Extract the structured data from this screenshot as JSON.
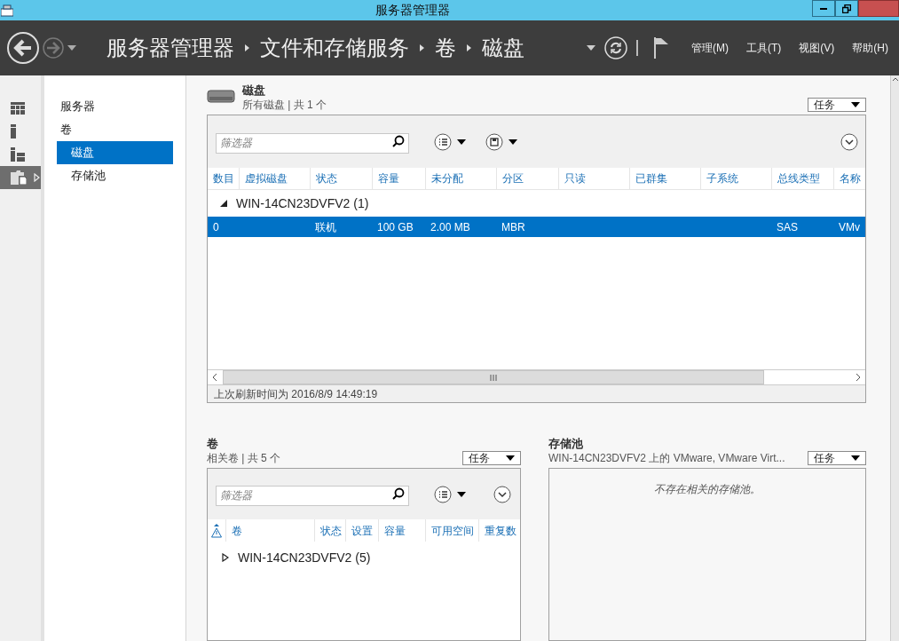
{
  "window": {
    "title": "服务器管理器"
  },
  "nav": {
    "back_enabled": true,
    "forward_enabled": false,
    "breadcrumb": [
      "服务器管理器",
      "文件和存储服务",
      "卷",
      "磁盘"
    ],
    "menus": [
      "管理(M)",
      "工具(T)",
      "视图(V)",
      "帮助(H)"
    ]
  },
  "rail": [
    {
      "kind": "dashboard",
      "selected": false
    },
    {
      "kind": "server",
      "selected": false
    },
    {
      "kind": "servers",
      "selected": false
    },
    {
      "kind": "files",
      "selected": true
    }
  ],
  "nav_panel": [
    {
      "label": "服务器",
      "selected": false
    },
    {
      "label": "卷",
      "selected": false,
      "children": [
        {
          "label": "磁盘",
          "selected": true
        },
        {
          "label": "存储池",
          "selected": false
        }
      ]
    }
  ],
  "disks": {
    "title": "磁盘",
    "subtitle": "所有磁盘 | 共 1 个",
    "tasks": "任务",
    "filter_placeholder": "筛选器",
    "columns": [
      "数目",
      "虚拟磁盘",
      "状态",
      "容量",
      "未分配",
      "分区",
      "只读",
      "已群集",
      "子系统",
      "总线类型",
      "名称"
    ],
    "groups": [
      {
        "label": "WIN-14CN23DVFV2 (1)",
        "expanded": true,
        "rows": [
          {
            "selected": true,
            "cells": [
              "0",
              null,
              "联机",
              "100 GB",
              "2.00 MB",
              "MBR",
              null,
              null,
              null,
              "SAS",
              "VMv"
            ]
          }
        ]
      }
    ],
    "footer": "上次刷新时间为 2016/8/9 14:49:19"
  },
  "volumes": {
    "title": "卷",
    "subtitle": "相关卷 | 共 5 个",
    "tasks": "任务",
    "filter_placeholder": "筛选器",
    "columns": [
      {
        "kind": "warning"
      },
      {
        "kind": "text",
        "label": "卷"
      },
      {
        "kind": "text",
        "label": "状态"
      },
      {
        "kind": "text",
        "label": "设置"
      },
      {
        "kind": "text",
        "label": "容量"
      },
      {
        "kind": "text",
        "label": "可用空间"
      },
      {
        "kind": "text",
        "label": "重复数"
      }
    ],
    "groups": [
      {
        "label": "WIN-14CN23DVFV2 (5)",
        "expanded": false
      }
    ]
  },
  "pools": {
    "title": "存储池",
    "subtitle": "WIN-14CN23DVFV2 上的 VMware, VMware Virt...",
    "tasks": "任务",
    "empty_message": "不存在相关的存储池。"
  }
}
